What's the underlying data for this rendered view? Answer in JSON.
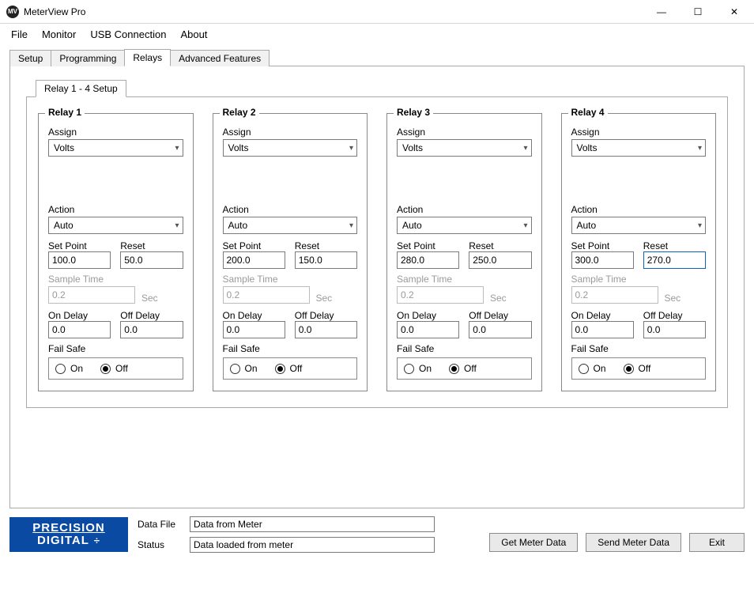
{
  "window": {
    "title": "MeterView Pro",
    "buttons": {
      "minimize": "—",
      "maximize": "☐",
      "close": "✕"
    }
  },
  "menu": [
    "File",
    "Monitor",
    "USB Connection",
    "About"
  ],
  "tabs": [
    "Setup",
    "Programming",
    "Relays",
    "Advanced Features"
  ],
  "activeTab": "Relays",
  "subtab": "Relay 1 - 4 Setup",
  "labels": {
    "assign": "Assign",
    "action": "Action",
    "setpoint": "Set Point",
    "reset": "Reset",
    "sample": "Sample Time",
    "sec": "Sec",
    "ondelay": "On Delay",
    "offdelay": "Off Delay",
    "failsafe": "Fail Safe",
    "on": "On",
    "off": "Off"
  },
  "relays": [
    {
      "title": "Relay 1",
      "assign": "Volts",
      "action": "Auto",
      "setpoint": "100.0",
      "reset": "50.0",
      "sample": "0.2",
      "ondelay": "0.0",
      "offdelay": "0.0",
      "failsafe": "Off",
      "resetFocused": false
    },
    {
      "title": "Relay 2",
      "assign": "Volts",
      "action": "Auto",
      "setpoint": "200.0",
      "reset": "150.0",
      "sample": "0.2",
      "ondelay": "0.0",
      "offdelay": "0.0",
      "failsafe": "Off",
      "resetFocused": false
    },
    {
      "title": "Relay 3",
      "assign": "Volts",
      "action": "Auto",
      "setpoint": "280.0",
      "reset": "250.0",
      "sample": "0.2",
      "ondelay": "0.0",
      "offdelay": "0.0",
      "failsafe": "Off",
      "resetFocused": false
    },
    {
      "title": "Relay 4",
      "assign": "Volts",
      "action": "Auto",
      "setpoint": "300.0",
      "reset": "270.0",
      "sample": "0.2",
      "ondelay": "0.0",
      "offdelay": "0.0",
      "failsafe": "Off",
      "resetFocused": true
    }
  ],
  "footer": {
    "brand1": "PRECISION",
    "brand2": "DIGITAL",
    "dataFileLabel": "Data File",
    "dataFile": "Data from Meter",
    "statusLabel": "Status",
    "status": "Data loaded from meter",
    "btnGet": "Get Meter Data",
    "btnSend": "Send Meter Data",
    "btnExit": "Exit"
  }
}
